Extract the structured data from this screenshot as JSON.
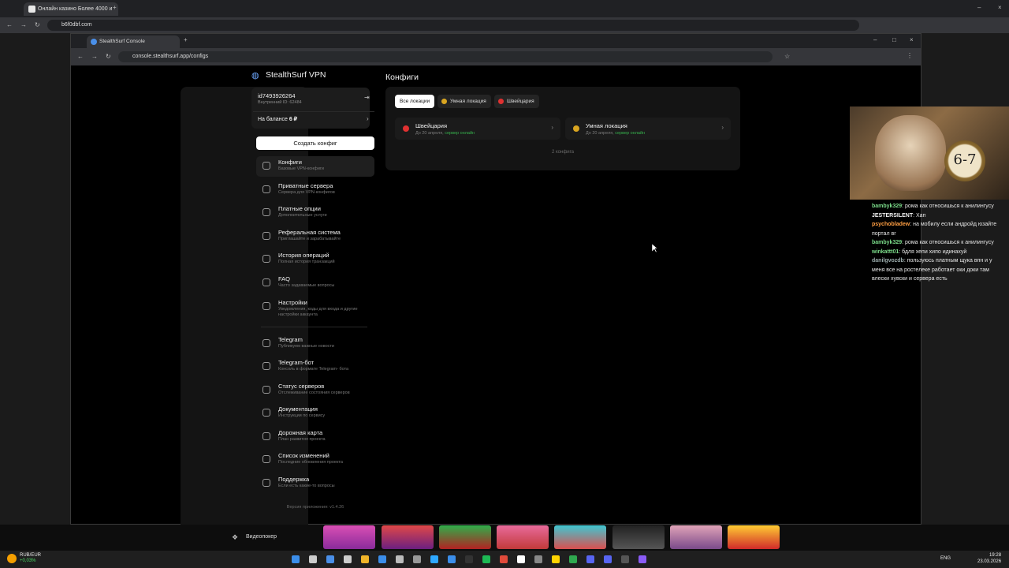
{
  "outer_browser": {
    "tab_title": "Онлайн казино Более 4000 и",
    "url": "b6f0dbf.com"
  },
  "inner_browser": {
    "tab_title": "StealthSurf Console",
    "url": "console.stealthsurf.app/configs"
  },
  "app": {
    "brand": "StealthSurf VPN",
    "user_id": "id7493926264",
    "internal_id": "Внутренний ID: 62484",
    "balance_label": "На балансе",
    "balance_value": "6 ₽",
    "create_button": "Создать конфиг",
    "nav": [
      {
        "title": "Конфиги",
        "sub": "Базовые VPN-конфиги",
        "icon": "list-icon",
        "active": true
      },
      {
        "title": "Приватные сервера",
        "sub": "Сервера для VPN-конфигов",
        "icon": "cloud-icon"
      },
      {
        "title": "Платные опции",
        "sub": "Дополнительные услуги",
        "icon": "grid-icon"
      },
      {
        "title": "Реферальная система",
        "sub": "Приглашайте и зарабатывайте",
        "icon": "user-plus-icon"
      },
      {
        "title": "История операций",
        "sub": "Полная история транзакций",
        "icon": "card-icon"
      },
      {
        "title": "FAQ",
        "sub": "Часто задаваемые вопросы",
        "icon": "chat-icon"
      },
      {
        "title": "Настройки",
        "sub": "Уведомления, коды для входа и другие настройки аккаунта",
        "icon": "gear-icon"
      },
      {
        "title": "Telegram",
        "sub": "Публикуем важные новости",
        "icon": "megaphone-icon"
      },
      {
        "title": "Telegram-бот",
        "sub": "Консоль в формате Telegram- бота",
        "icon": "bot-icon"
      },
      {
        "title": "Статус серверов",
        "sub": "Отслеживание состояния серверов",
        "icon": "signal-icon"
      },
      {
        "title": "Документация",
        "sub": "Инструкции по сервису",
        "icon": "book-icon"
      },
      {
        "title": "Дорожная карта",
        "sub": "План развития проекта",
        "icon": "map-icon"
      },
      {
        "title": "Список изменений",
        "sub": "Последние обновления проекта",
        "icon": "sparkle-icon"
      },
      {
        "title": "Поддержка",
        "sub": "Если есть какие-то вопросы",
        "icon": "support-icon"
      }
    ],
    "version": "Версия приложения: v1.4.26",
    "main_title": "Конфиги",
    "filters": [
      "Все локации",
      "Умная локация",
      "Швейцария"
    ],
    "configs": [
      {
        "name": "Швейцария",
        "until": "До 20 апреля,",
        "status": "сервер онлайн"
      },
      {
        "name": "Умная локация",
        "until": "До 20 апреля,",
        "status": "сервер онлайн"
      }
    ],
    "config_count": "2 конфига"
  },
  "webcam_overlay": {
    "watch_text": "6-7"
  },
  "chat": [
    {
      "user": "bambyk329",
      "text": "рома как относишься к анилингусу",
      "color": "green"
    },
    {
      "user": "JESTERSILENT",
      "text": "Хап",
      "color": "white"
    },
    {
      "user": "psychobladew",
      "text": "на мобилу если андройд юзайте портал вг",
      "color": "orange"
    },
    {
      "user": "bambyk329",
      "text": "рома как относишься к анилингусу",
      "color": "green"
    },
    {
      "user": "winkattt01",
      "text": "бдля хепи хипо идинахуй",
      "color": "green"
    },
    {
      "user": "danilgvozdb",
      "text": "пользуюсь платным щука впн и у меня все на ростелеке работает оки доки там влески хувски и сервера есть",
      "color": "grey"
    }
  ],
  "bottom_strip": {
    "label": "Видеопокер"
  },
  "taskbar": {
    "fx_pair": "RUB/EUR",
    "fx_change": "+0,03%",
    "lang": "ENG",
    "time": "19:28",
    "date": "23.03.2026"
  }
}
